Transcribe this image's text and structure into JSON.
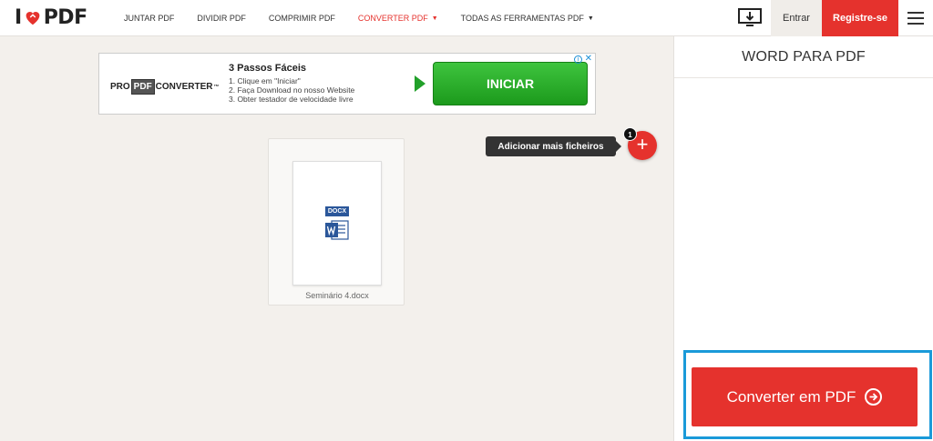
{
  "logo": {
    "pre": "I",
    "post": "PDF"
  },
  "nav": [
    {
      "label": "JUNTAR PDF",
      "active": false
    },
    {
      "label": "DIVIDIR PDF",
      "active": false
    },
    {
      "label": "COMPRIMIR PDF",
      "active": false
    },
    {
      "label": "CONVERTER PDF",
      "active": true,
      "dropdown": true
    },
    {
      "label": "TODAS AS FERRAMENTAS PDF",
      "active": false,
      "dropdown": true
    }
  ],
  "header": {
    "login_label": "Entrar",
    "register_label": "Registre-se"
  },
  "ad": {
    "brand_pre": "PRO",
    "brand_box": "PDF",
    "brand_post": "CONVERTER",
    "brand_tm": "™",
    "title": "3 Passos Fáceis",
    "lines": [
      "1. Clique em \"Iniciar\"",
      "2. Faça Download no nosso Website",
      "3. Obter testador de velocidade livre"
    ],
    "button_label": "INICIAR"
  },
  "file": {
    "type_label": "DOCX",
    "name": "Seminário 4.docx"
  },
  "upload": {
    "tooltip": "Adicionar mais ficheiros",
    "count": "1"
  },
  "sidebar": {
    "title": "WORD PARA PDF",
    "convert_label": "Converter em PDF"
  },
  "colors": {
    "brand_red": "#e5322d",
    "highlight_blue": "#1a9ad9",
    "word_blue": "#2b579a",
    "ad_green": "#22a02a"
  }
}
